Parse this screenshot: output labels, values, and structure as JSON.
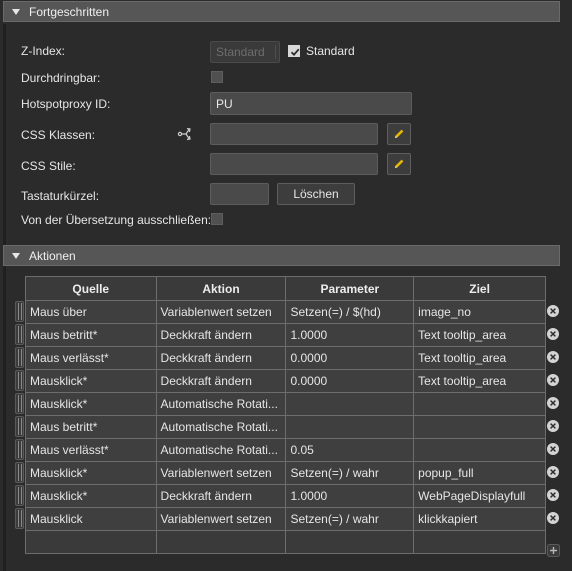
{
  "sections": {
    "advanced": "Fortgeschritten",
    "actions": "Aktionen"
  },
  "fields": {
    "z_index_label": "Z-Index:",
    "z_index_value": "Standard",
    "z_index_default_label": "Standard",
    "z_index_default_checked": true,
    "penetrable_label": "Durchdringbar:",
    "penetrable_checked": false,
    "hotspot_proxy_label": "Hotspotproxy ID:",
    "hotspot_proxy_value": "PU",
    "css_classes_label": "CSS Klassen:",
    "css_classes_value": "",
    "css_styles_label": "CSS Stile:",
    "css_styles_value": "",
    "shortcut_label": "Tastaturkürzel:",
    "shortcut_value": "",
    "clear_button": "Löschen",
    "exclude_translation_label": "Von der Übersetzung ausschließen:",
    "exclude_translation_checked": false
  },
  "actions_table": {
    "columns": [
      "Quelle",
      "Aktion",
      "Parameter",
      "Ziel"
    ],
    "rows": [
      [
        "Maus über",
        "Variablenwert setzen",
        "Setzen(=) / $(hd)",
        "image_no"
      ],
      [
        "Maus betritt*",
        "Deckkraft ändern",
        "1.0000",
        "Text tooltip_area"
      ],
      [
        "Maus verlässt*",
        "Deckkraft ändern",
        "0.0000",
        "Text tooltip_area"
      ],
      [
        "Mausklick*",
        "Deckkraft ändern",
        "0.0000",
        "Text tooltip_area"
      ],
      [
        "Mausklick*",
        "Automatische Rotati...",
        "",
        ""
      ],
      [
        "Maus betritt*",
        "Automatische Rotati...",
        "",
        ""
      ],
      [
        "Maus verlässt*",
        "Automatische Rotati...",
        "0.05",
        ""
      ],
      [
        "Mausklick*",
        "Variablenwert setzen",
        "Setzen(=) / wahr",
        "popup_full"
      ],
      [
        "Mausklick*",
        "Deckkraft ändern",
        "1.0000",
        "WebPageDisplayfull"
      ],
      [
        "Mausklick",
        "Variablenwert setzen",
        "Setzen(=) / wahr",
        "klickkapiert"
      ]
    ]
  },
  "icons": {
    "section_toggle": "triangle-down-icon",
    "css_link": "share-branch-icon",
    "edit": "pencil-icon",
    "remove": "circle-x-icon",
    "add": "plus-icon",
    "drag": "drag-handle-icon"
  },
  "colors": {
    "background": "#2b2b2b",
    "header": "#565656",
    "input": "#4a4a4a",
    "pencil": "#e8b800"
  }
}
